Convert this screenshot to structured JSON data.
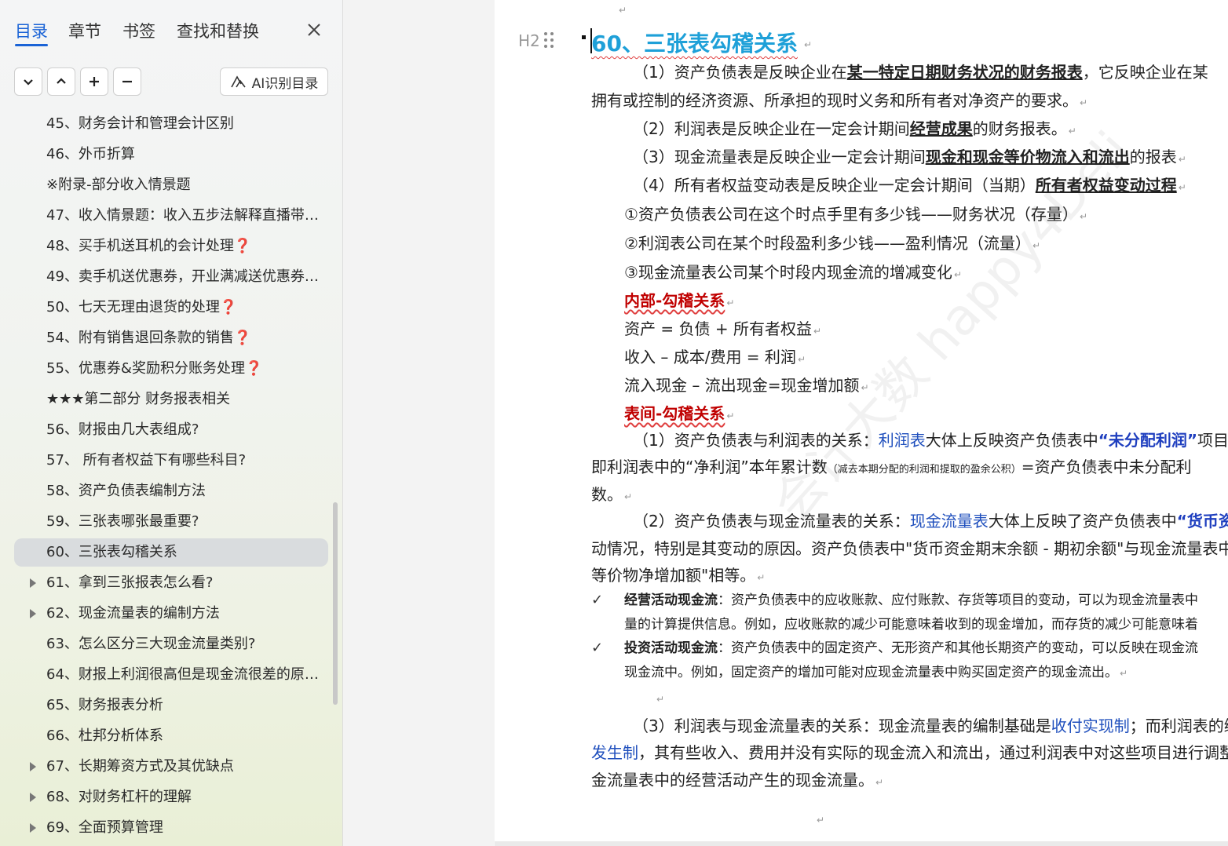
{
  "nav": {
    "tabs": [
      "目录",
      "章节",
      "书签",
      "查找和替换"
    ],
    "active_tab": 0,
    "toolbar": {
      "buttons": [
        "chevron-down-icon",
        "chevron-up-icon",
        "plus-icon",
        "minus-icon"
      ],
      "ai_label": "AI识别目录"
    },
    "items": [
      {
        "text": "45、财务会计和管理会计区别",
        "q": "",
        "caret": false
      },
      {
        "text": "46、外币折算",
        "q": "",
        "caret": false
      },
      {
        "text": "※附录-部分收入情景题",
        "q": "",
        "caret": false
      },
      {
        "text": "47、收入情景题：收入五步法解释直播带…",
        "q": "",
        "caret": false
      },
      {
        "text": "48、买手机送耳机的会计处理",
        "q": "❓",
        "caret": false
      },
      {
        "text": "49、卖手机送优惠券，开业满减送优惠券…",
        "q": "",
        "caret": false
      },
      {
        "text": "50、七天无理由退货的处理",
        "q": "❓",
        "caret": false
      },
      {
        "text": "54、附有销售退回条款的销售",
        "q": "❓",
        "caret": false
      },
      {
        "text": "55、优惠券&奖励积分账务处理",
        "q": "❓",
        "caret": false
      },
      {
        "text": "★★★第二部分  财务报表相关",
        "q": "",
        "caret": false
      },
      {
        "text": "56、财报由几大表组成?",
        "q": "",
        "caret": false
      },
      {
        "text": "57、  所有者权益下有哪些科目?",
        "q": "",
        "caret": false
      },
      {
        "text": "58、资产负债表编制方法",
        "q": "",
        "caret": false
      },
      {
        "text": "59、三张表哪张最重要?",
        "q": "",
        "caret": false
      },
      {
        "text": "60、三张表勾稽关系",
        "q": "",
        "caret": false,
        "selected": true
      },
      {
        "text": "61、拿到三张报表怎么看?",
        "q": "",
        "caret": true
      },
      {
        "text": "62、现金流量表的编制方法",
        "q": "",
        "caret": true
      },
      {
        "text": "63、怎么区分三大现金流量类别?",
        "q": "",
        "caret": false
      },
      {
        "text": "64、财报上利润很高但是现金流很差的原…",
        "q": "",
        "caret": false
      },
      {
        "text": "65、财务报表分析",
        "q": "",
        "caret": false
      },
      {
        "text": "66、杜邦分析体系",
        "q": "",
        "caret": false
      },
      {
        "text": "67、长期筹资方式及其优缺点",
        "q": "",
        "caret": true
      },
      {
        "text": "68、对财务杠杆的理解",
        "q": "",
        "caret": true
      },
      {
        "text": "69、全面预算管理",
        "q": "",
        "caret": true
      }
    ]
  },
  "doc": {
    "heading_style": "H2",
    "heading": "60、三张表勾稽关系",
    "watermark": "会计大数 happy4Deli",
    "p1": {
      "a": "（1）资产负债表是反映企业在",
      "b": "某一特定日期财务状况的财务报表",
      "c": "，它反映企业在某"
    },
    "p1b": "拥有或控制的经济资源、所承担的现时义务和所有者对净资产的要求。",
    "p2": {
      "a": "（2）利润表是反映企业在一定会计期间",
      "b": "经营成果",
      "c": "的财务报表。"
    },
    "p3": {
      "a": "（3）现金流量表是反映企业一定会计期间",
      "b": "现金和现金等价物流入和流出",
      "c": "的报表"
    },
    "p4": {
      "a": "（4）所有者权益变动表是反映企业一定会计期间（当期）",
      "b": "所有者权益变动过程"
    },
    "c1": "①资产负债表公司在这个时点手里有多少钱——财务状况（存量）",
    "c2": "②利润表公司在某个时段盈利多少钱——盈利情况（流量）",
    "c3": "③现金流量表公司某个时段内现金流的增减变化",
    "inner_title": "内部-勾稽关系",
    "eq1": "资产  =  负债  +  所有者权益",
    "eq2": "收入  –  成本/费用  =  利润",
    "eq3": "流入现金  –  流出现金=现金增加额",
    "between_title": "表间-勾稽关系",
    "r1": {
      "a": "（1）资产负债表与利润表的关系：",
      "b": "利润表",
      "c": "大体上反映资产负债表中",
      "d": "“未分配利润”",
      "e": "项目"
    },
    "r1b": {
      "a": "即利润表中的“净利润”本年累计数",
      "b": "（减去本期分配的利润和提取的盈余公积）",
      "c": "=资产负债表中未分配利"
    },
    "r1c": "数。",
    "r2": {
      "a": "（2）资产负债表与现金流量表的关系：",
      "b": "现金流量表",
      "c": "大体上反映了资产负债表中",
      "d": "“货币资"
    },
    "r2b": "动情况，特别是其变动的原因。资产负债表中\"货币资金期末余额 - 期初余额\"与现金流量表中",
    "r2c": "等价物净增加额\"相等。",
    "k1": {
      "check": "✓",
      "a": "经营活动现金流",
      "b": "：资产负债表中的应收账款、应付账款、存货等项目的变动，可以为现金流量表中"
    },
    "k1b": "量的计算提供信息。例如，应收账款的减少可能意味着收到的现金增加，而存货的减少可能意味着",
    "k2": {
      "check": "✓",
      "a": "投资活动现金流",
      "b": "：资产负债表中的固定资产、无形资产和其他长期资产的变动，可以反映在现金流"
    },
    "k2b": "现金流中。例如，固定资产的增加可能对应现金流量表中购买固定资产的现金流出。",
    "r3": {
      "a": "（3）利润表与现金流量表的关系：现金流量表的编制基础是",
      "b": "收付实现制",
      "c": "；而利润表的编"
    },
    "r3b": {
      "a": "发生制",
      "b": "，其有些收入、费用并没有实际的现金流入和流出，通过利润表中对这些项目进行调整"
    },
    "r3c": "金流量表中的经营活动产生的现金流量。"
  },
  "colors": {
    "accent": "#1a63d6",
    "heading": "#1ea0d8",
    "red": "#c00000",
    "link_blue": "#1f4fbd"
  }
}
